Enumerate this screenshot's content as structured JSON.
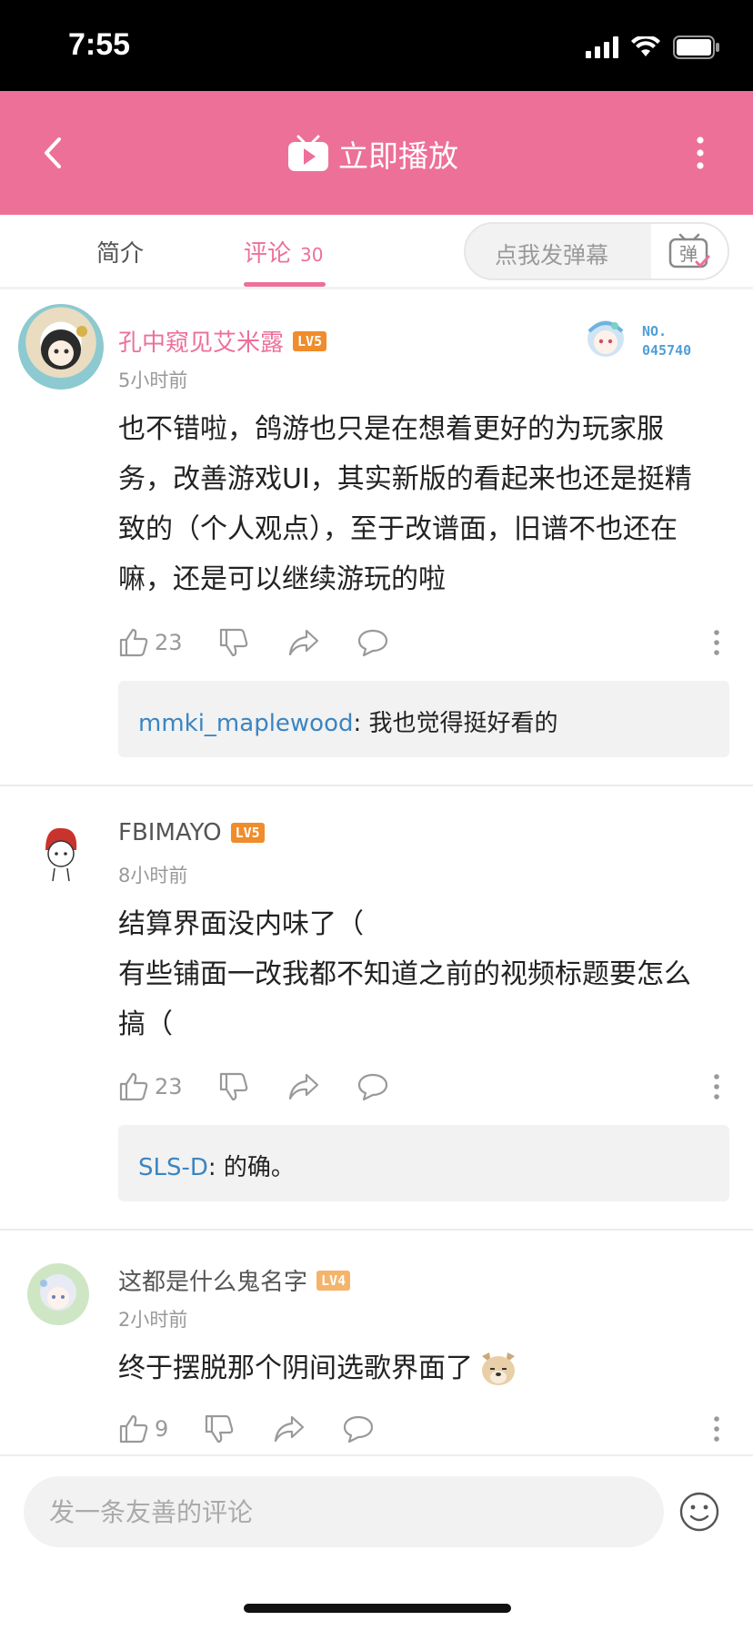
{
  "status_bar": {
    "time": "7:55"
  },
  "header": {
    "title": "立即播放"
  },
  "tabs": {
    "intro_label": "简介",
    "comments_label": "评论",
    "comments_count": "30"
  },
  "danmaku": {
    "placeholder": "点我发弹幕",
    "button_char": "弹"
  },
  "comments": [
    {
      "username": "孔中窥见艾米露",
      "level": "LV5",
      "time": "5小时前",
      "lines": [
        "也不错啦，鸽游也只是在想着更好的为玩家服",
        "务，改善游戏UI，其实新版的看起来也还是挺精",
        "致的（个人观点），至于改谱面，旧谱不也还在",
        "嘛，还是可以继续游玩的啦"
      ],
      "likes": "23",
      "badge_no": "NO.",
      "badge_num": "045740",
      "reply": {
        "user": "mmki_maplewood",
        "text": ": 我也觉得挺好看的"
      }
    },
    {
      "username": "FBIMAYO",
      "level": "LV5",
      "time": "8小时前",
      "lines": [
        "结算界面没内味了（",
        "有些铺面一改我都不知道之前的视频标题要怎么",
        "搞（"
      ],
      "likes": "23",
      "reply": {
        "user": "SLS-D",
        "text": ": 的确。"
      }
    },
    {
      "username": "这都是什么鬼名字",
      "level": "LV4",
      "time": "2小时前",
      "lines": [
        "终于摆脱那个阴间选歌界面了"
      ],
      "likes": "9"
    }
  ],
  "bottom": {
    "placeholder": "发一条友善的评论"
  },
  "colors": {
    "accent": "#ed7099",
    "lv5": "#f08c2b",
    "lv4": "#f5b46a",
    "reply_user": "#3a85c2"
  }
}
